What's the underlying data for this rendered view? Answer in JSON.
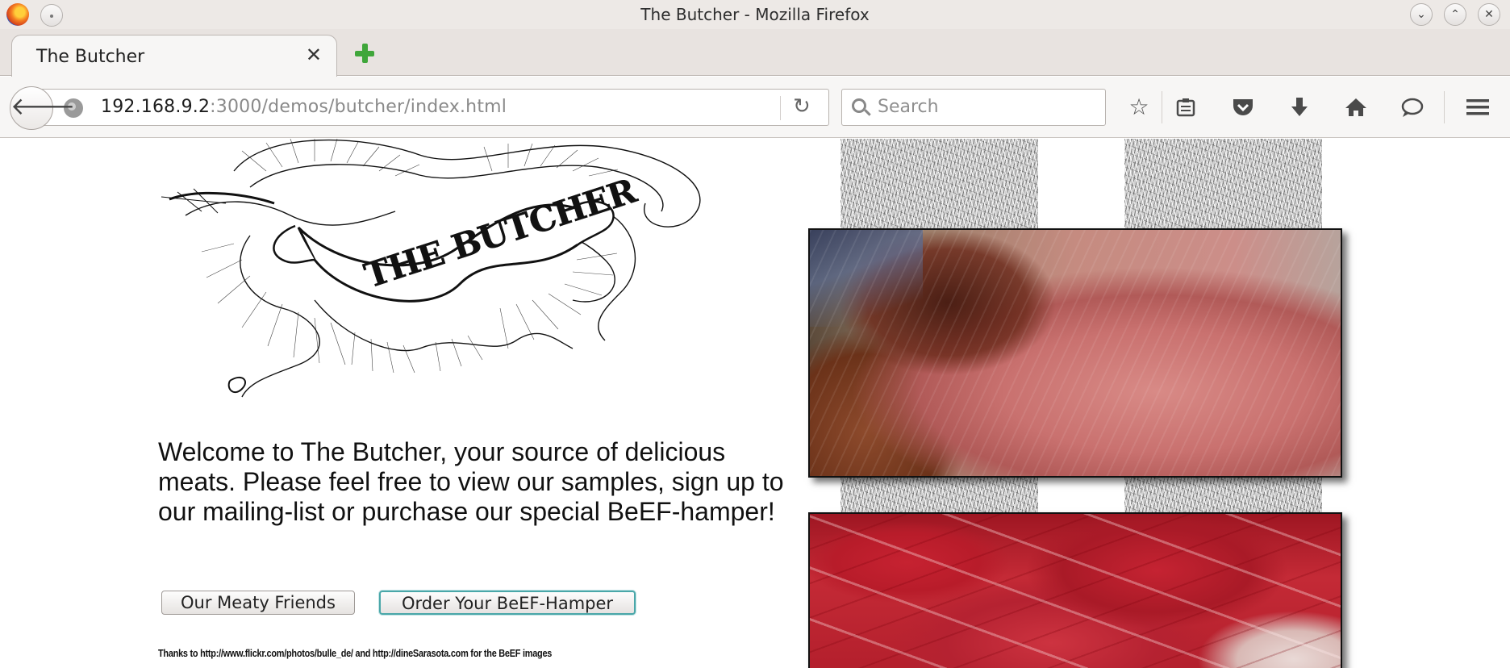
{
  "window": {
    "title": "The Butcher - Mozilla Firefox"
  },
  "tabs": [
    {
      "label": "The Butcher",
      "close_glyph": "✕"
    }
  ],
  "newtab_icon": "plus-icon",
  "navbar": {
    "url_host": "192.168.9.2",
    "url_path": ":3000/demos/butcher/index.html",
    "search_placeholder": "Search"
  },
  "toolbar_icons": [
    "bookmark-star-icon",
    "reading-list-icon",
    "pocket-icon",
    "download-icon",
    "home-icon",
    "chat-icon",
    "menu-icon"
  ],
  "page": {
    "logo_text": "THE BUTCHER",
    "welcome": "Welcome to The Butcher, your source of delicious meats. Please feel free to view our samples, sign up to our mailing-list or purchase our special BeEF-hamper!",
    "buttons": {
      "friends": "Our Meaty Friends",
      "hamper": "Order Your BeEF-Hamper"
    },
    "credits": "Thanks to http://www.flickr.com/photos/bulle_de/ and http://dineSarasota.com for the BeEF images"
  },
  "colors": {
    "accent_focus": "#4aa7a9",
    "newtab_green": "#3fa63a",
    "meat_red": "#b81c2a"
  }
}
